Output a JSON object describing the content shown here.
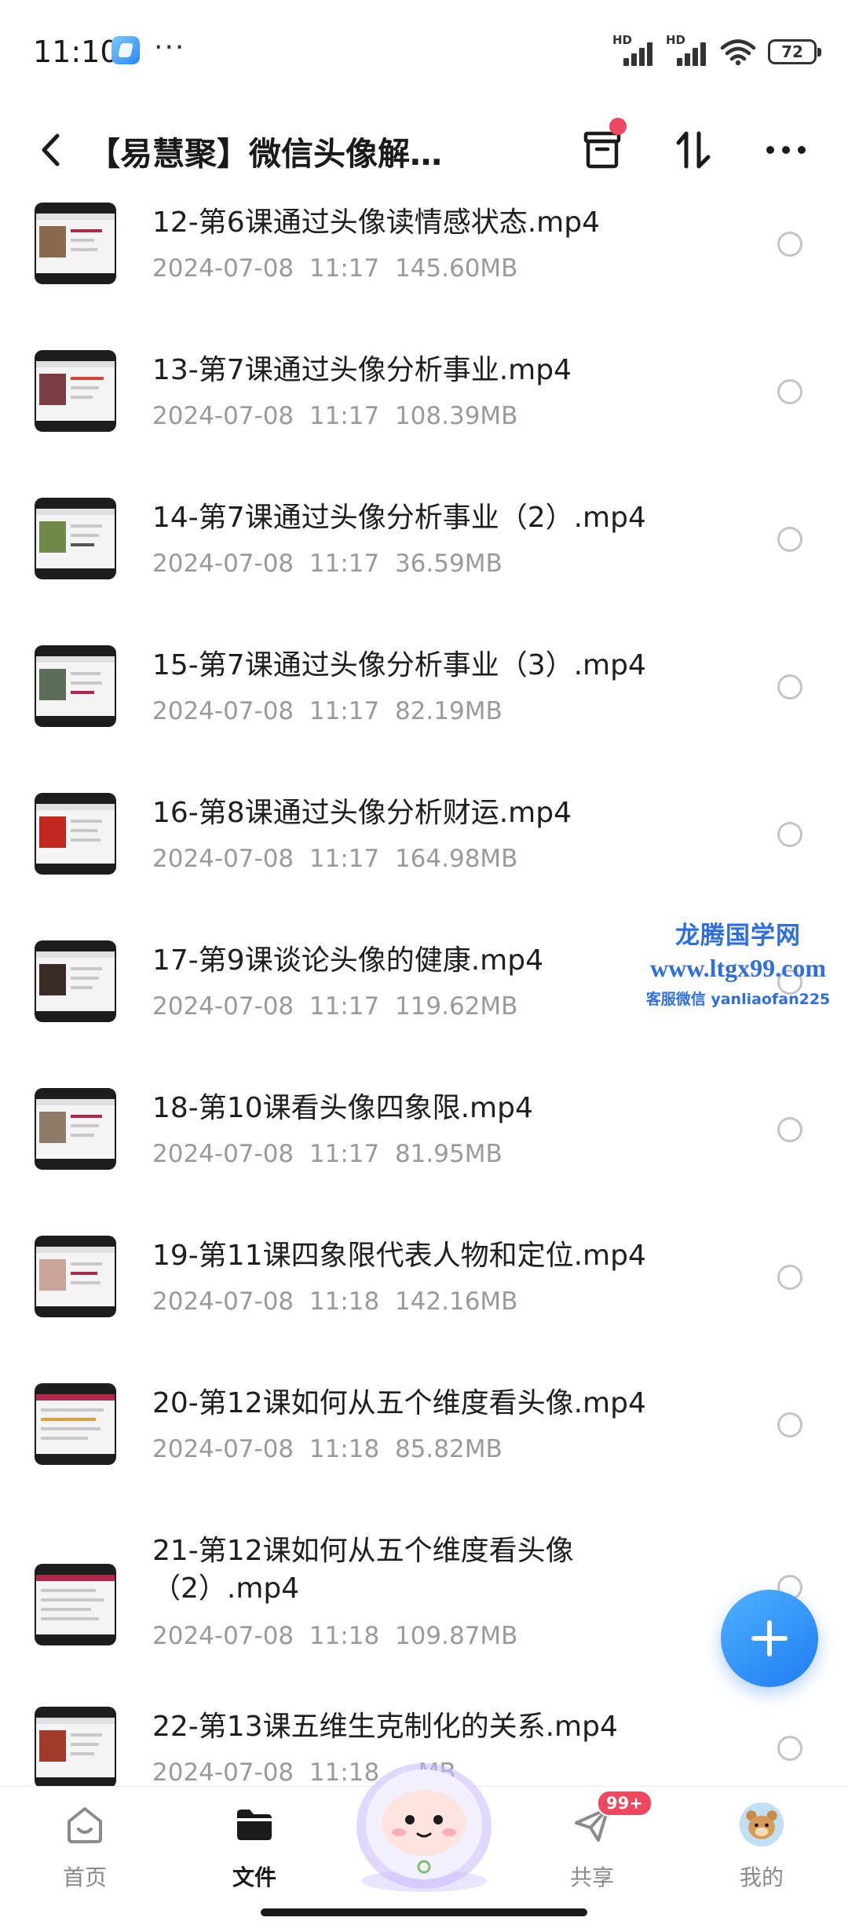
{
  "status_bar": {
    "time": "11:10",
    "more": "···",
    "signal_label_1": "HD",
    "signal_label_2": "HD",
    "battery": "72"
  },
  "header": {
    "title": "【易慧聚】微信头像解…",
    "icons": [
      "back-icon",
      "archive-icon",
      "sort-icon",
      "more-icon"
    ]
  },
  "files": [
    {
      "name": "12-第6课通过头像读情感状态.mp4",
      "date": "2024-07-08",
      "time": "11:17",
      "size": "145.60MB"
    },
    {
      "name": "13-第7课通过头像分析事业.mp4",
      "date": "2024-07-08",
      "time": "11:17",
      "size": "108.39MB"
    },
    {
      "name": "14-第7课通过头像分析事业（2）.mp4",
      "date": "2024-07-08",
      "time": "11:17",
      "size": "36.59MB"
    },
    {
      "name": "15-第7课通过头像分析事业（3）.mp4",
      "date": "2024-07-08",
      "time": "11:17",
      "size": "82.19MB"
    },
    {
      "name": "16-第8课通过头像分析财运.mp4",
      "date": "2024-07-08",
      "time": "11:17",
      "size": "164.98MB"
    },
    {
      "name": "17-第9课谈论头像的健康.mp4",
      "date": "2024-07-08",
      "time": "11:17",
      "size": "119.62MB"
    },
    {
      "name": "18-第10课看头像四象限.mp4",
      "date": "2024-07-08",
      "time": "11:17",
      "size": "81.95MB"
    },
    {
      "name": "19-第11课四象限代表人物和定位.mp4",
      "date": "2024-07-08",
      "time": "11:18",
      "size": "142.16MB"
    },
    {
      "name": "20-第12课如何从五个维度看头像.mp4",
      "date": "2024-07-08",
      "time": "11:18",
      "size": "85.82MB"
    },
    {
      "name": "21-第12课如何从五个维度看头像（2）.mp4",
      "date": "2024-07-08",
      "time": "11:18",
      "size": "109.87MB"
    },
    {
      "name": "22-第13课五维生克制化的关系.mp4",
      "date": "2024-07-08",
      "time": "11:18",
      "size": "...MB"
    }
  ],
  "watermark": {
    "name": "龙腾国学网",
    "url": "www.ltgx99.com",
    "contact": "客服微信 yanliaofan225"
  },
  "fab": {
    "icon": "plus-icon"
  },
  "bottom_nav": {
    "items": [
      {
        "label": "首页",
        "icon": "home-icon",
        "active": false
      },
      {
        "label": "文件",
        "icon": "folder-icon",
        "active": true
      },
      {
        "label": "",
        "icon": "mascot-icon",
        "active": false
      },
      {
        "label": "共享",
        "icon": "send-icon",
        "active": false,
        "badge": "99+"
      },
      {
        "label": "我的",
        "icon": "avatar-icon",
        "active": false
      }
    ]
  },
  "colors": {
    "accent": "#2a86f4",
    "badge": "#ef4760",
    "text_primary": "#1e1e1e",
    "text_secondary": "#9a9a9a"
  }
}
